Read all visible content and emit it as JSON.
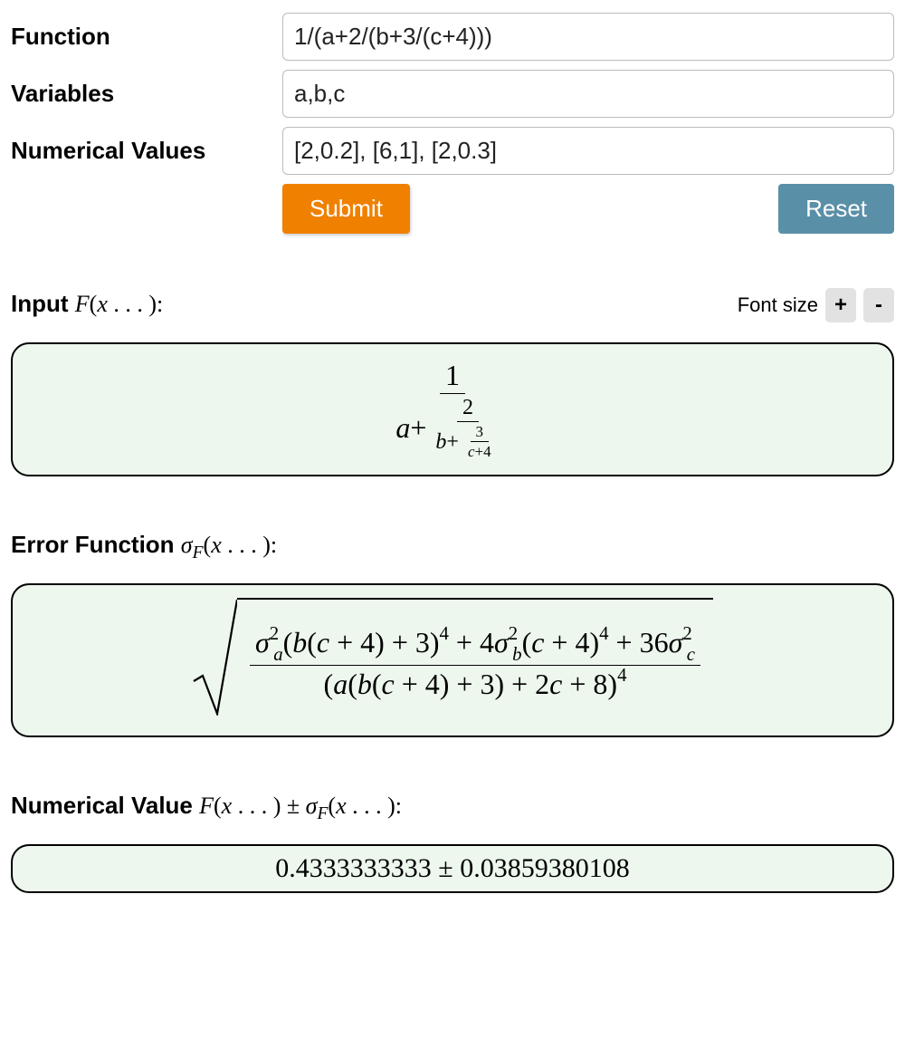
{
  "form": {
    "function_label": "Function",
    "function_value": "1/(a+2/(b+3/(c+4)))",
    "variables_label": "Variables",
    "variables_value": "a,b,c",
    "numvalues_label": "Numerical Values",
    "numvalues_value": "[2,0.2], [6,1], [2,0.3]",
    "submit_label": "Submit",
    "reset_label": "Reset"
  },
  "fontsize": {
    "label": "Font size",
    "plus": "+",
    "minus": "-"
  },
  "sections": {
    "input_title_prefix": "Input ",
    "input_title_math": "F(x…):",
    "error_title_prefix": "Error Function ",
    "error_title_math": "σF(x…):",
    "numeric_title_prefix": "Numerical Value ",
    "numeric_title_math": "F(x…) ± σF(x…):"
  },
  "input_frac": {
    "top": "1",
    "a": "a",
    "plus": " + ",
    "two": "2",
    "b": "b",
    "three": "3",
    "c": "c",
    "four": "4"
  },
  "error_expr": {
    "num_1": "σ",
    "num_1_sup": "2",
    "num_1_sub": "a",
    "num_2_open": "(",
    "num_2_b": "b",
    "num_2_open2": "(",
    "num_2_c": "c",
    "num_2_plus4": " + 4) + 3)",
    "num_2_pow": "4",
    "num_3": " + 4",
    "num_3_sigma": "σ",
    "num_3_sup": "2",
    "num_3_sub": "b",
    "num_3_open": "(",
    "num_3_c": "c",
    "num_3_tail": " + 4)",
    "num_3_pow": "4",
    "num_4": " + 36",
    "num_4_sigma": "σ",
    "num_4_sup": "2",
    "num_4_sub": "c",
    "den_open": "(",
    "den_a": "a",
    "den_open2": "(",
    "den_b": "b",
    "den_open3": "(",
    "den_c": "c",
    "den_mid": " + 4) + 3) + 2",
    "den_c2": "c",
    "den_tail": " + 8)",
    "den_pow": "4"
  },
  "numeric_result": {
    "value": "0.4333333333",
    "pm": " ± ",
    "error": "0.03859380108"
  }
}
